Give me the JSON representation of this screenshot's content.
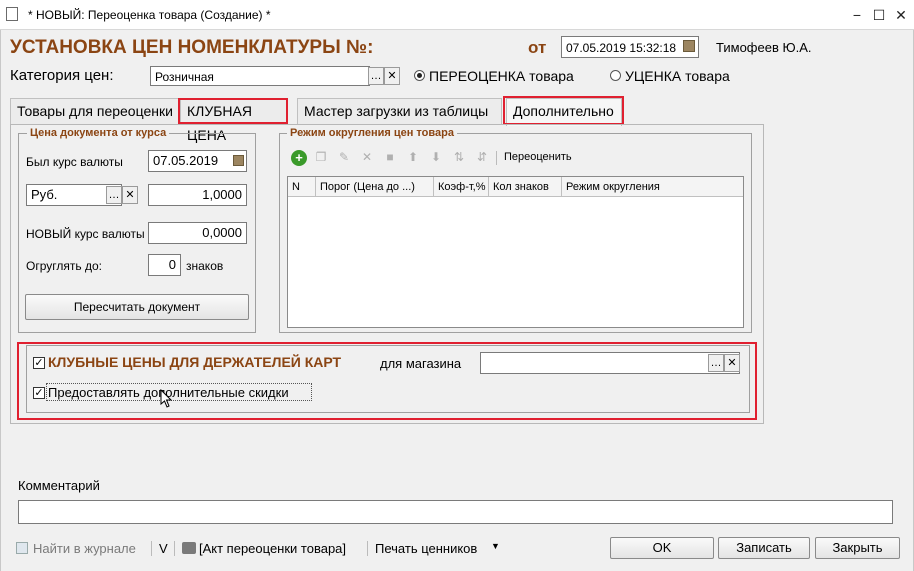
{
  "window": {
    "title": "* НОВЫЙ: Переоценка товара (Создание) *",
    "btn_min": "−",
    "btn_max": "☐",
    "btn_close": "✕"
  },
  "header": {
    "title": "УСТАНОВКА ЦЕН НОМЕНКЛАТУРЫ №:",
    "from_label": "от",
    "date": "07.05.2019 15:32:18",
    "author": "Тимофеев Ю.А."
  },
  "price_category": {
    "label": "Категория цен:",
    "value": "Розничная",
    "radio_reprice": "ПЕРЕОЦЕНКА товара",
    "radio_markdown": "УЦЕНКА товара",
    "selected": "reprice"
  },
  "tabs": [
    {
      "label": "Товары для переоценки"
    },
    {
      "label": "КЛУБНАЯ ЦЕНА"
    },
    {
      "label": "Мастер загрузки из таблицы"
    },
    {
      "label": "Дополнительно"
    }
  ],
  "rate_group": {
    "title": "Цена документа от курса",
    "old_rate_label": "Был курс валюты",
    "old_rate_date": "07.05.2019",
    "currency": "Руб.",
    "old_rate_value": "1,0000",
    "new_rate_label": "НОВЫЙ курс валюты",
    "new_rate_value": "0,0000",
    "round_label": "Огруглять до:",
    "round_value": "0",
    "round_unit": "знаков",
    "recalc_button": "Пересчитать документ"
  },
  "rounding_group": {
    "title": "Режим округления цен товара",
    "reprice_button": "Переоценить",
    "columns": [
      "N",
      "Порог (Цена до ...)",
      "Коэф-т,%",
      "Кол знаков",
      "Режим округления"
    ]
  },
  "club": {
    "checkbox1_label": "КЛУБНЫЕ ЦЕНЫ ДЛЯ ДЕРЖАТЕЛЕЙ КАРТ",
    "checkbox1_checked": true,
    "store_label": "для магазина",
    "store_value": "",
    "checkbox2_label": "Предоставлять дополнительные скидки",
    "checkbox2_checked": true
  },
  "comment": {
    "label": "Комментарий",
    "value": ""
  },
  "bottom": {
    "journal": "Найти в журнале",
    "v": "V",
    "act": "[Акт переоценки товара]",
    "print_tags": "Печать ценников",
    "ok": "OK",
    "save": "Записать",
    "close": "Закрыть"
  },
  "colors": {
    "accent": "#8b4513",
    "highlight": "#e02030"
  }
}
